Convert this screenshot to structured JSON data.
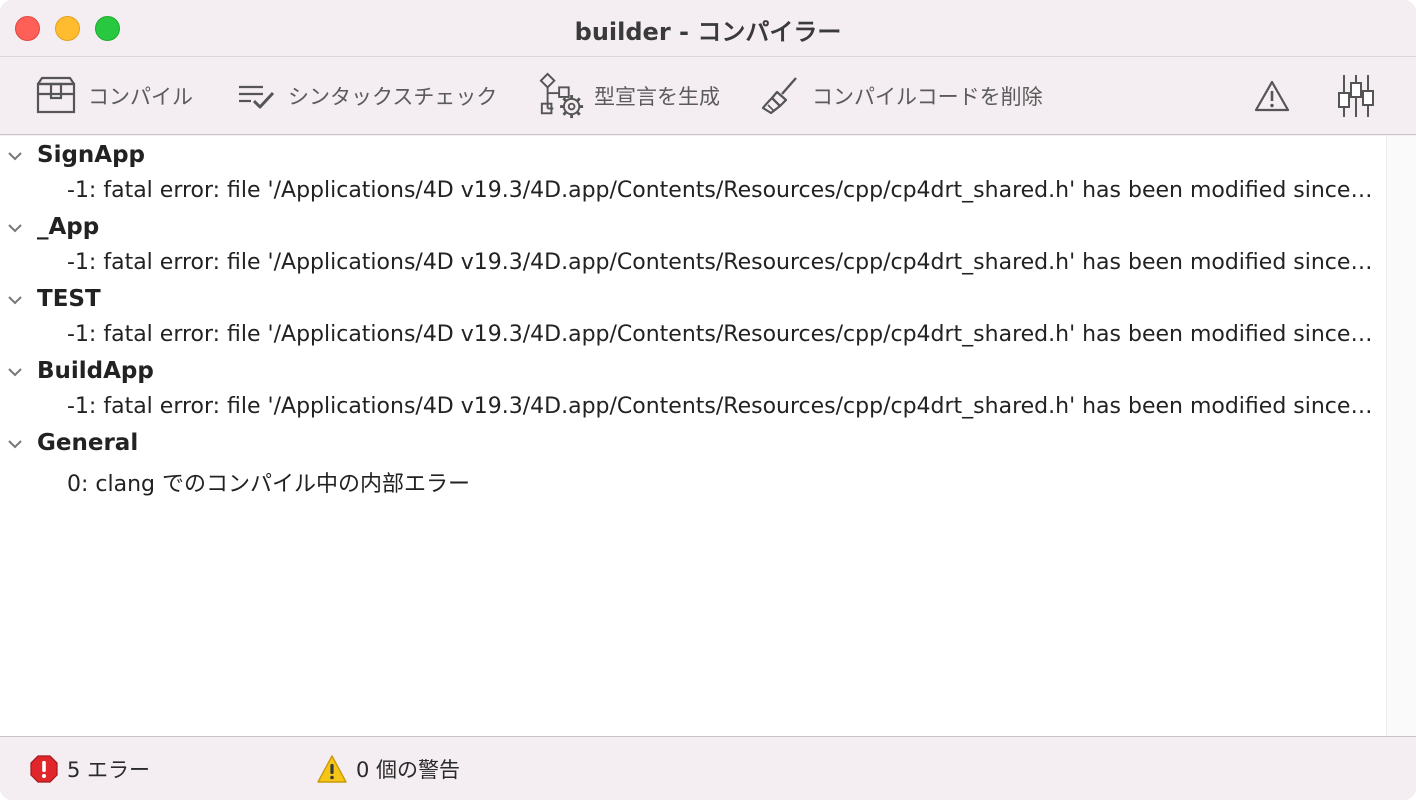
{
  "window": {
    "title": "builder - コンパイラー"
  },
  "toolbar": {
    "compile_label": "コンパイル",
    "syntax_check_label": "シンタックスチェック",
    "generate_typing_label": "型宣言を生成",
    "clear_code_label": "コンパイルコードを削除"
  },
  "results": {
    "groups": [
      {
        "name": "SignApp",
        "message": "-1: fatal error: file '/Applications/4D v19.3/4D.app/Contents/Resources/cpp/cp4drt_shared.h' has been modified since the precompiled header was built"
      },
      {
        "name": "_App",
        "message": "-1: fatal error: file '/Applications/4D v19.3/4D.app/Contents/Resources/cpp/cp4drt_shared.h' has been modified since the precompiled header was built"
      },
      {
        "name": "TEST",
        "message": "-1: fatal error: file '/Applications/4D v19.3/4D.app/Contents/Resources/cpp/cp4drt_shared.h' has been modified since the precompiled header was built"
      },
      {
        "name": "BuildApp",
        "message": "-1: fatal error: file '/Applications/4D v19.3/4D.app/Contents/Resources/cpp/cp4drt_shared.h' has been modified since the precompiled header was built"
      },
      {
        "name": "General",
        "message": "0: clang でのコンパイル中の内部エラー"
      }
    ]
  },
  "status": {
    "errors": "5 エラー",
    "warnings": "0 個の警告"
  },
  "colors": {
    "close": "#fe5f57",
    "minimize": "#febc2e",
    "zoom": "#28c840",
    "error": "#e0262b",
    "warning": "#f5c518"
  }
}
